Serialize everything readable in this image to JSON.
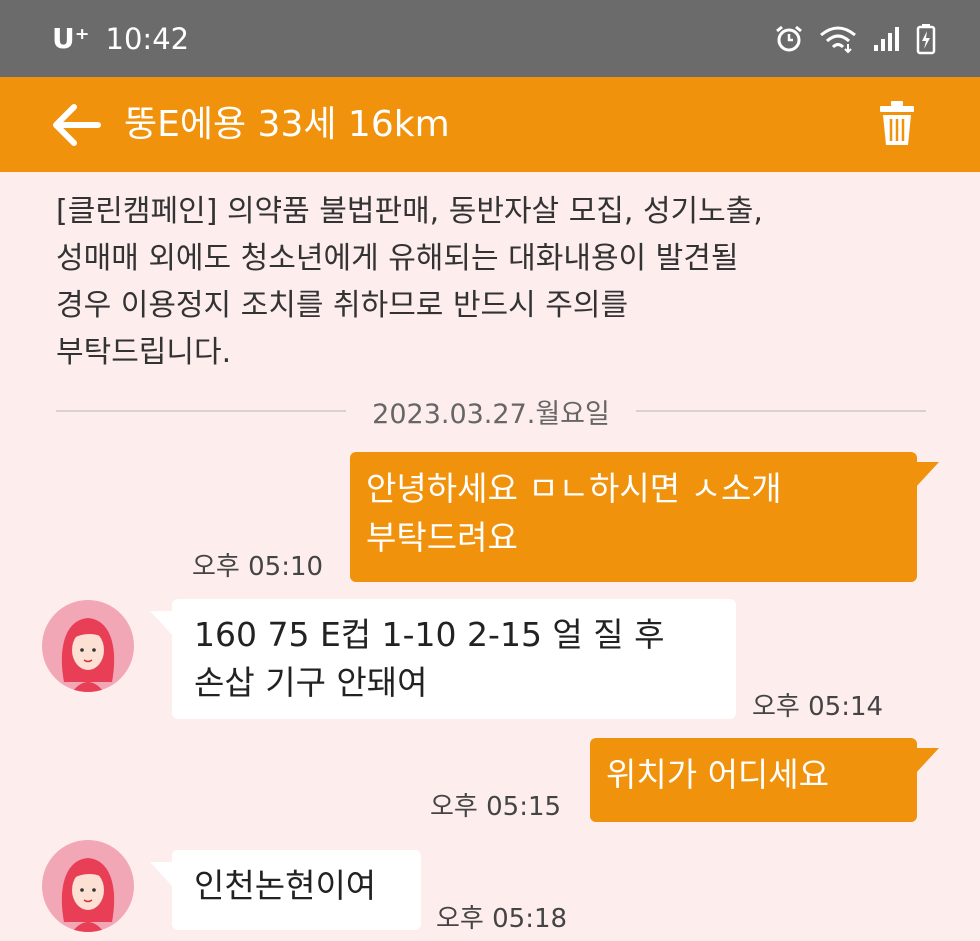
{
  "status_bar": {
    "carrier": "U⁺",
    "time": "10:42",
    "icons": [
      "alarm-icon",
      "wifi-icon",
      "signal-icon",
      "battery-charging-icon"
    ]
  },
  "app_bar": {
    "title": "뚱E에용 33세 16km",
    "back_icon": "arrow-left-icon",
    "delete_icon": "trash-icon"
  },
  "notice": {
    "lines": [
      "[클린캠페인] 의약품 불법판매, 동반자살 모집, 성기노출,",
      "성매매 외에도 청소년에게 유해되는 대화내용이 발견될",
      "경우 이용정지 조치를 취하므로 반드시 주의를",
      "부탁드립니다."
    ]
  },
  "date_divider": "2023.03.27.월요일",
  "messages": [
    {
      "side": "out",
      "lines": [
        "안녕하세요 ㅁㄴ하시면 ㅅ소개",
        "부탁드려요"
      ],
      "time": "오후 05:10"
    },
    {
      "side": "in",
      "lines": [
        "160 75 E컵 1-10 2-15 얼 질 후",
        "손삽 기구 안돼여"
      ],
      "time": "오후 05:14"
    },
    {
      "side": "out",
      "lines": [
        "위치가 어디세요"
      ],
      "time": "오후 05:15"
    },
    {
      "side": "in",
      "lines": [
        "인천논현이여"
      ],
      "time": "오후 05:18"
    }
  ],
  "colors": {
    "accent": "#f0920c",
    "status_bar": "#6b6b6b",
    "background": "#fdeeed",
    "incoming_bubble": "#ffffff",
    "avatar_bg": "#f2a7b7"
  }
}
